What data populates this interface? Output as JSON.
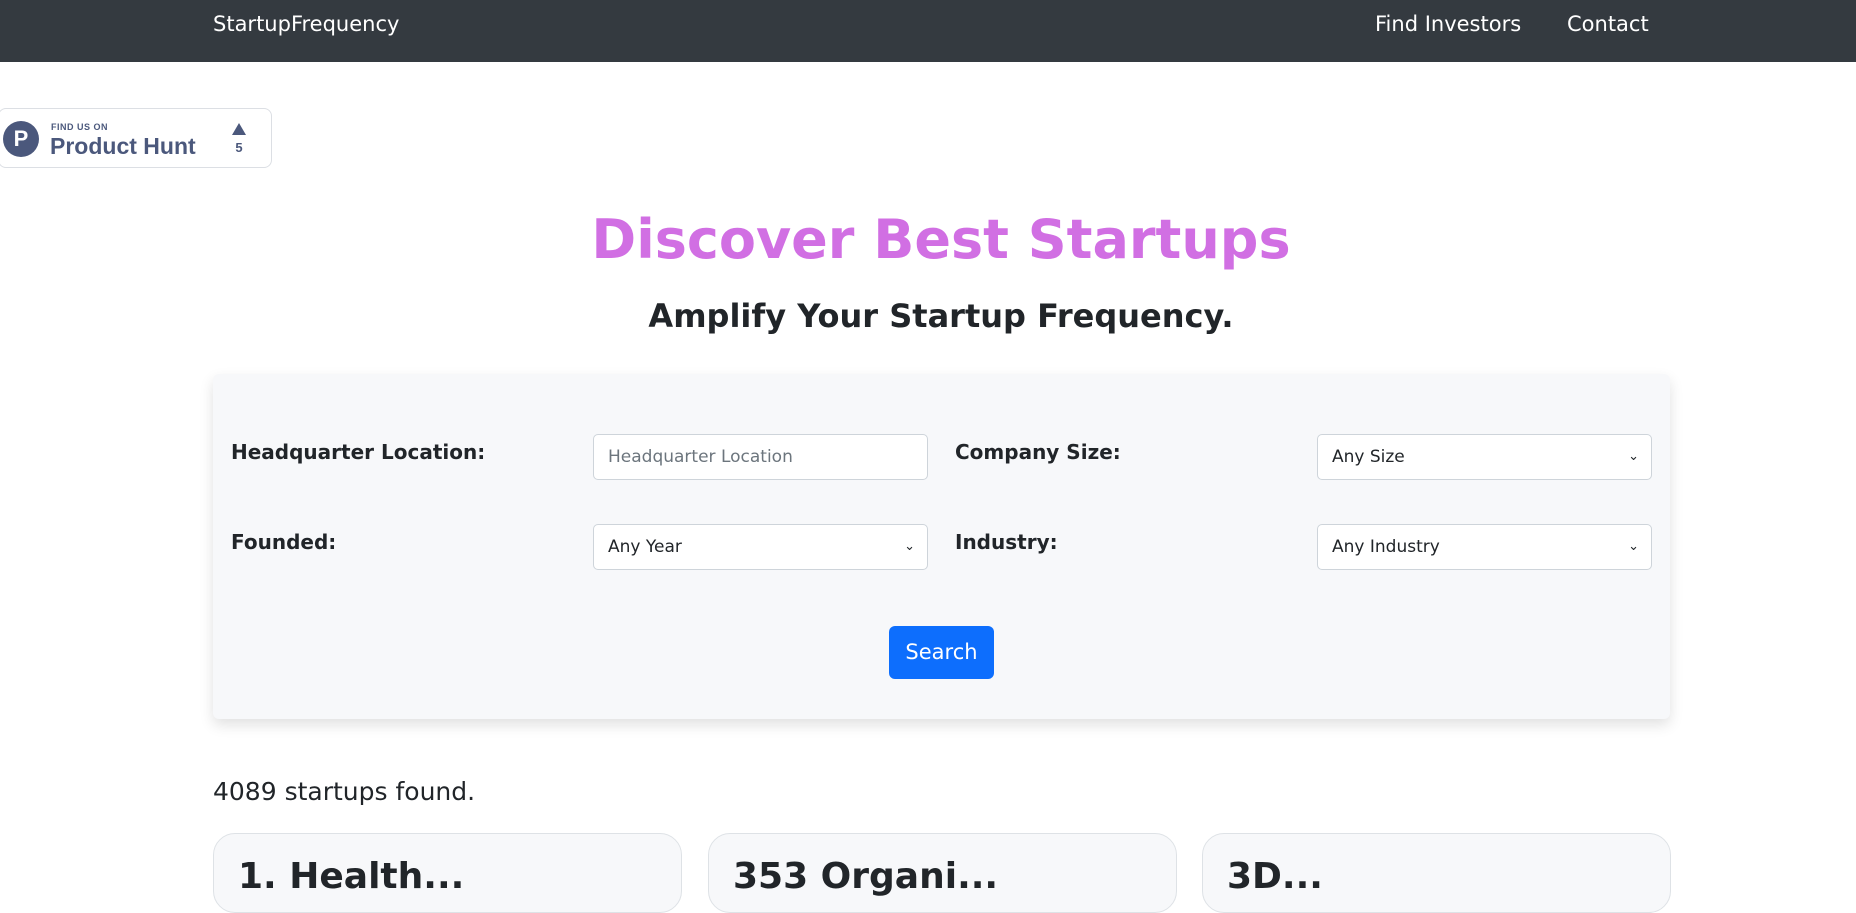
{
  "nav": {
    "brand": "StartupFrequency",
    "links": [
      "Find Investors",
      "Contact"
    ]
  },
  "product_hunt": {
    "find_text": "FIND US ON",
    "name": "Product Hunt",
    "logo_letter": "P",
    "votes": "5"
  },
  "hero": {
    "title": "Discover Best Startups",
    "subtitle": "Amplify Your Startup Frequency."
  },
  "search": {
    "hq_label": "Headquarter Location:",
    "hq_placeholder": "Headquarter Location",
    "size_label": "Company Size:",
    "size_value": "Any Size",
    "founded_label": "Founded:",
    "founded_value": "Any Year",
    "industry_label": "Industry:",
    "industry_value": "Any Industry",
    "button": "Search"
  },
  "results": {
    "count_text": "4089 startups found.",
    "cards": [
      "1. Health...",
      "353 Organi...",
      "3D..."
    ]
  },
  "colors": {
    "navbar": "#343a40",
    "title": "#d16fe3",
    "button": "#0d6efd"
  }
}
